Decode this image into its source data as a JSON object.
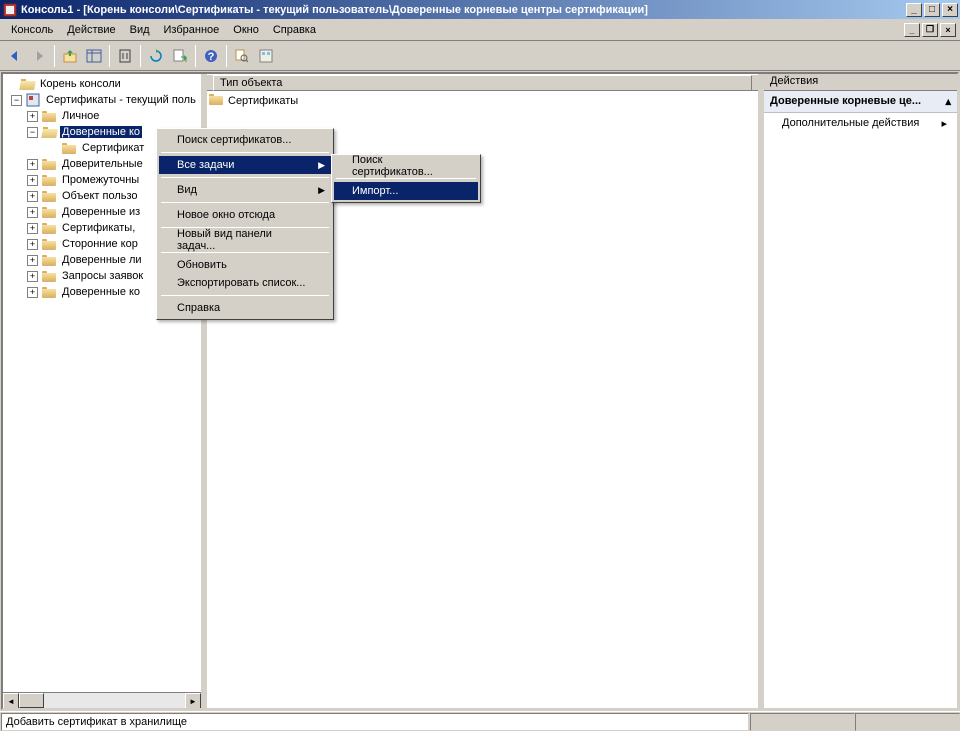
{
  "titlebar": {
    "text": "Консоль1 - [Корень консоли\\Сертификаты - текущий пользователь\\Доверенные корневые центры сертификации]"
  },
  "menubar": {
    "items": [
      "Консоль",
      "Действие",
      "Вид",
      "Избранное",
      "Окно",
      "Справка"
    ]
  },
  "tree": {
    "root": "Корень консоли",
    "cert_user": "Сертификаты - текущий поль",
    "personal": "Личное",
    "trusted_root": "Доверенные ко",
    "certificates": "Сертификат",
    "items": [
      "Доверительные",
      "Промежуточны",
      "Объект пользо",
      "Доверенные из",
      "Сертификаты, ",
      "Сторонние кор",
      "Доверенные ли",
      "Запросы заявок",
      "Доверенные ко"
    ]
  },
  "list": {
    "header": "Тип объекта",
    "item0": "Сертификаты"
  },
  "actions": {
    "header": "Действия",
    "section": "Доверенные корневые це...",
    "item0": "Дополнительные действия"
  },
  "context_menu": {
    "search": "Поиск сертификатов...",
    "all_tasks": "Все задачи",
    "view": "Вид",
    "new_window": "Новое окно отсюда",
    "new_taskpad": "Новый вид панели задач...",
    "refresh": "Обновить",
    "export": "Экспортировать список...",
    "help": "Справка"
  },
  "submenu": {
    "search": "Поиск сертификатов...",
    "import": "Импорт..."
  },
  "statusbar": {
    "text": "Добавить сертификат в хранилище"
  }
}
